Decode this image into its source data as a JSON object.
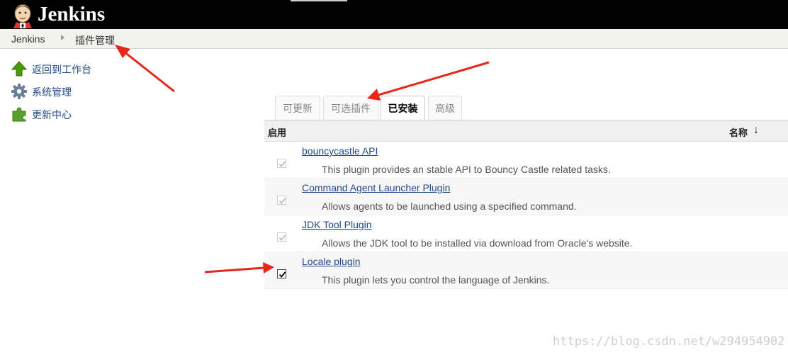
{
  "app": {
    "brand": "Jenkins"
  },
  "breadcrumb": {
    "root": "Jenkins",
    "current": "插件管理"
  },
  "sidebar": {
    "items": [
      {
        "label": "返回到工作台",
        "icon": "up-arrow-icon"
      },
      {
        "label": "系统管理",
        "icon": "gear-icon"
      },
      {
        "label": "更新中心",
        "icon": "puzzle-icon"
      }
    ]
  },
  "tabs": [
    {
      "label": "可更新",
      "active": false
    },
    {
      "label": "可选插件",
      "active": false
    },
    {
      "label": "已安装",
      "active": true
    },
    {
      "label": "高级",
      "active": false
    }
  ],
  "table": {
    "col_enabled": "启用",
    "col_name": "名称",
    "sort_arrow": "↓",
    "rows": [
      {
        "name": "bouncycastle API",
        "description": "This plugin provides an stable API to Bouncy Castle related tasks.",
        "checked": true,
        "disabled": true
      },
      {
        "name": "Command Agent Launcher Plugin",
        "description": "Allows agents to be launched using a specified command.",
        "checked": true,
        "disabled": true
      },
      {
        "name": "JDK Tool Plugin",
        "description": "Allows the JDK tool to be installed via download from Oracle's website.",
        "checked": true,
        "disabled": true
      },
      {
        "name": "Locale plugin",
        "description": "This plugin lets you control the language of Jenkins.",
        "checked": true,
        "disabled": false
      }
    ]
  },
  "watermark": "https://blog.csdn.net/w294954902",
  "colors": {
    "topbar": "#000000",
    "link": "#204a87",
    "annotation_arrow": "#e8261c",
    "green_icon": "#4e9a06"
  }
}
